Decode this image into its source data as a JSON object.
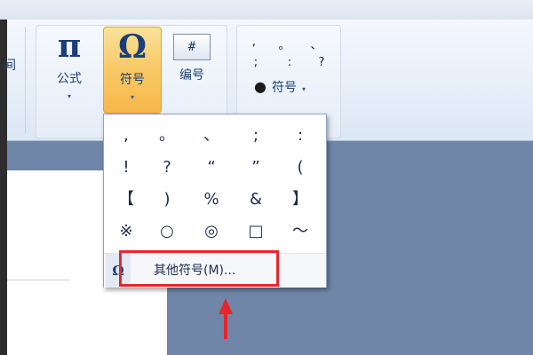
{
  "ribbon": {
    "partial_label": "间",
    "buttons": [
      {
        "glyph": "π",
        "label": "公式",
        "arrow": "▾"
      },
      {
        "glyph": "Ω",
        "label": "符号",
        "arrow": "▾"
      },
      {
        "glyph": "#",
        "label": "编号"
      }
    ],
    "quick_symbols_row1": [
      ",",
      "。",
      "、"
    ],
    "quick_symbols_row2": [
      ";",
      ":",
      "?"
    ],
    "symbol_dropdown": {
      "dot": "●",
      "label": "符号",
      "arrow": "▾"
    }
  },
  "popup": {
    "rows": [
      [
        ",",
        "。",
        "、",
        ";",
        ":"
      ],
      [
        "!",
        "?",
        "“",
        "”",
        "("
      ],
      [
        "【",
        ")",
        "%",
        "&",
        "】"
      ],
      [
        "※",
        "○",
        "◎",
        "□",
        "～"
      ]
    ],
    "footer_icon": "Ω",
    "more_label": "其他符号(M)..."
  },
  "colors": {
    "highlight": "#e8262a",
    "accent_pressed": "#f8c865"
  }
}
